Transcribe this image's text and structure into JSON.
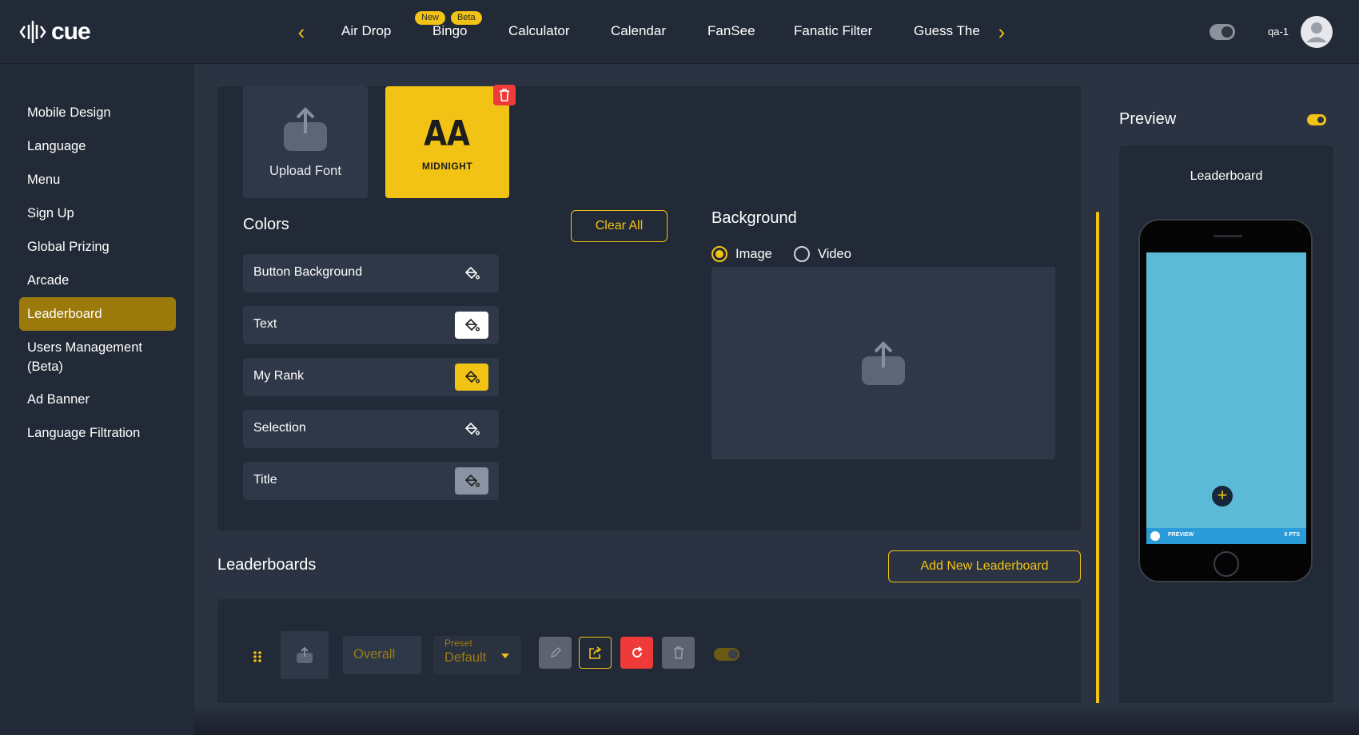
{
  "app": {
    "brand": "cue",
    "user": "qa-1"
  },
  "nav": {
    "items": [
      {
        "label": "Air Drop"
      },
      {
        "label": "Bingo",
        "badges": [
          "New",
          "Beta"
        ]
      },
      {
        "label": "Calculator"
      },
      {
        "label": "Calendar"
      },
      {
        "label": "FanSee"
      },
      {
        "label": "Fanatic Filter"
      },
      {
        "label": "Guess The"
      }
    ]
  },
  "sidebar": {
    "items": [
      {
        "label": "Mobile Design"
      },
      {
        "label": "Language"
      },
      {
        "label": "Menu"
      },
      {
        "label": "Sign Up"
      },
      {
        "label": "Global Prizing"
      },
      {
        "label": "Arcade"
      },
      {
        "label": "Leaderboard",
        "active": true
      },
      {
        "label": "Users Management (Beta)"
      },
      {
        "label": "Ad Banner"
      },
      {
        "label": "Language Filtration"
      }
    ]
  },
  "fonts": {
    "upload_label": "Upload Font",
    "selected_preview": "AA",
    "selected_name": "MIDNIGHT"
  },
  "colors": {
    "title": "Colors",
    "clear_all": "Clear All",
    "rows": [
      {
        "label": "Button Background",
        "swatch": "transparent"
      },
      {
        "label": "Text",
        "swatch": "#ffffff"
      },
      {
        "label": "My Rank",
        "swatch": "#f2c314"
      },
      {
        "label": "Selection",
        "swatch": "transparent"
      },
      {
        "label": "Title",
        "swatch": "#8a93a3"
      }
    ]
  },
  "background": {
    "title": "Background",
    "options": [
      "Image",
      "Video"
    ],
    "selected": "Image"
  },
  "leaderboards": {
    "title": "Leaderboards",
    "add_button": "Add New Leaderboard",
    "row": {
      "name": "Overall",
      "preset_label": "Preset",
      "preset_value": "Default"
    }
  },
  "preview": {
    "title": "Preview",
    "screen_title": "Leaderboard",
    "bar_left": "PREVIEW",
    "bar_right": "0 PTS"
  },
  "theme": {
    "accent": "#f2c314",
    "danger": "#ef3a3a",
    "bg": "#2b3342",
    "panel": "#232a37"
  }
}
